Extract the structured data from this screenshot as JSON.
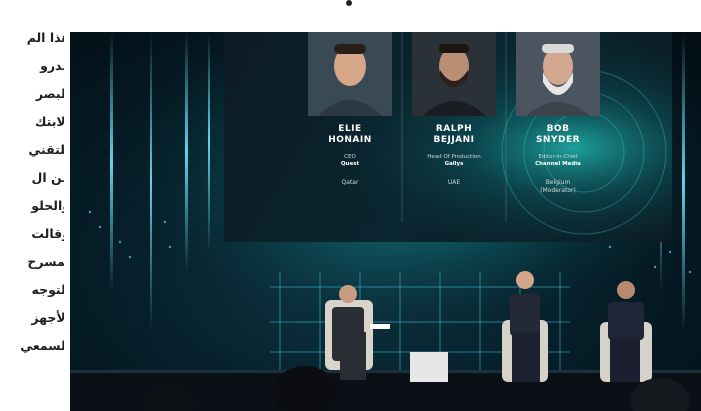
{
  "article_lines": [
    "هذا الم",
    "مدرو",
    "البصر",
    "الابتك",
    "للتقني",
    "من ال",
    "والحلو",
    "وقالت",
    "لمسرح",
    "التوجه",
    "الأجهز",
    "السمعي"
  ],
  "speakers": [
    {
      "name_line1": "ELIE",
      "name_line2": "HONAIN",
      "role": "CEO",
      "company": "Quest",
      "location_line1": "Qatar",
      "location_line2": ""
    },
    {
      "name_line1": "RALPH",
      "name_line2": "BEJJANI",
      "role": "Head Of Production",
      "company": "Gallys",
      "location_line1": "UAE",
      "location_line2": ""
    },
    {
      "name_line1": "BOB",
      "name_line2": "SNYDER",
      "role": "Editor-in-Chief",
      "company": "Channel Media",
      "location_line1": "Belgium",
      "location_line2": "(Moderator)"
    }
  ]
}
